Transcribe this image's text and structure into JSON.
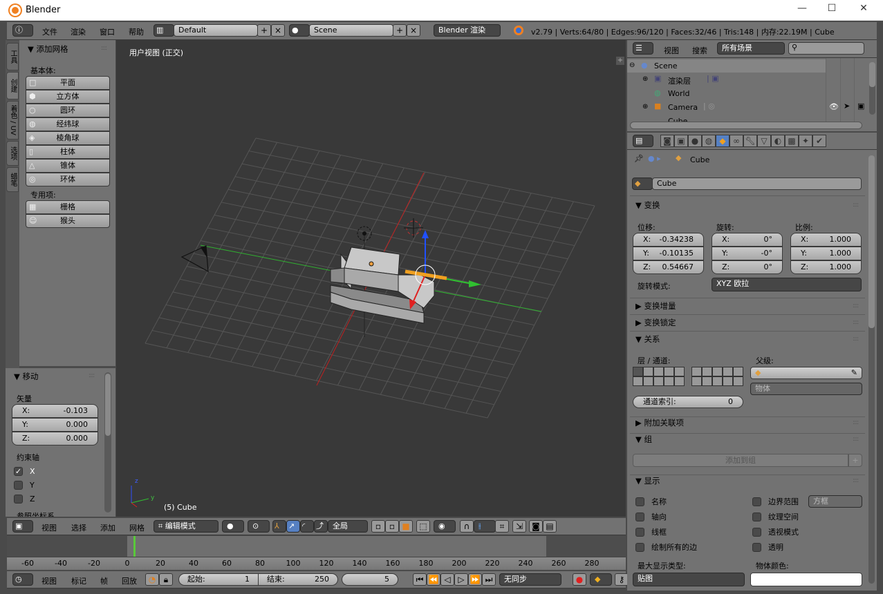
{
  "window": {
    "title": "Blender",
    "minimize": "—",
    "maximize": "☐",
    "close": "✕"
  },
  "info_header": {
    "menus": [
      "文件",
      "渲染",
      "窗口",
      "帮助"
    ],
    "layout": "Default",
    "scene": "Scene",
    "engine": "Blender 渲染",
    "stats": "v2.79 | Verts:64/80 | Edges:96/120 | Faces:32/46 | Tris:148 | 内存:22.19M | Cube"
  },
  "tool_tabs": [
    "工具",
    "创建",
    "着色 / UV",
    "选项",
    "蜡笔"
  ],
  "add_mesh": {
    "title": "添加网格",
    "primitives_label": "基本体:",
    "primitives": [
      "平面",
      "立方体",
      "圆环",
      "经纬球",
      "棱角球",
      "柱体",
      "锥体",
      "环体"
    ],
    "special_label": "专用项:",
    "special": [
      "栅格",
      "猴头"
    ]
  },
  "operator": {
    "title": "移动",
    "vector_label": "矢量",
    "vector": [
      {
        "axis": "X:",
        "value": "-0.103"
      },
      {
        "axis": "Y:",
        "value": "0.000"
      },
      {
        "axis": "Z:",
        "value": "0.000"
      }
    ],
    "constraint_label": "约束轴",
    "constraints": [
      {
        "axis": "X",
        "checked": true
      },
      {
        "axis": "Y",
        "checked": false
      },
      {
        "axis": "Z",
        "checked": false
      }
    ],
    "orientation_label": "参照坐标系"
  },
  "viewport": {
    "view_label": "用户视图 (正交)",
    "object_label": "(5) Cube",
    "axis_z": "z",
    "axis_y": "y",
    "colors": {
      "background": "#393939",
      "x_axis": "#c02020",
      "y_axis": "#30b030",
      "active": "#f0a020"
    }
  },
  "view3d_header": {
    "menus": [
      "视图",
      "选择",
      "添加",
      "网格"
    ],
    "mode": "编辑模式",
    "orientation": "全局"
  },
  "timeline": {
    "ticks": [
      "-60",
      "-40",
      "-20",
      "0",
      "20",
      "40",
      "60",
      "80",
      "100",
      "120",
      "140",
      "160",
      "180",
      "200",
      "220",
      "240",
      "260",
      "280"
    ],
    "current_frame": 5,
    "menus": [
      "视图",
      "标记",
      "帧",
      "回放"
    ],
    "start_label": "起始:",
    "start": "1",
    "end_label": "结束:",
    "end": "250",
    "frame": "5",
    "sync": "无同步"
  },
  "outliner": {
    "menus": [
      "视图",
      "搜索"
    ],
    "filter": "所有场景",
    "search_placeholder": "",
    "items": [
      {
        "label": "Scene"
      },
      {
        "label": "渲染层"
      },
      {
        "label": "World"
      },
      {
        "label": "Camera"
      },
      {
        "label": "Cube"
      }
    ]
  },
  "properties": {
    "breadcrumb": "Cube",
    "object_name": "Cube",
    "transform": {
      "title": "变换",
      "location_label": "位移:",
      "rotation_label": "旋转:",
      "scale_label": "比例:",
      "location": [
        {
          "axis": "X:",
          "value": "-0.34238"
        },
        {
          "axis": "Y:",
          "value": "-0.10135"
        },
        {
          "axis": "Z:",
          "value": "0.54667"
        }
      ],
      "rotation": [
        {
          "axis": "X:",
          "value": "0°"
        },
        {
          "axis": "Y:",
          "value": "-0°"
        },
        {
          "axis": "Z:",
          "value": "0°"
        }
      ],
      "scale": [
        {
          "axis": "X:",
          "value": "1.000"
        },
        {
          "axis": "Y:",
          "value": "1.000"
        },
        {
          "axis": "Z:",
          "value": "1.000"
        }
      ],
      "rotation_mode_label": "旋转模式:",
      "rotation_mode": "XYZ 欧拉"
    },
    "delta_transform": "变换增量",
    "transform_locks": "变换锁定",
    "relations": {
      "title": "关系",
      "layers_label": "层 / 通道:",
      "parent_label": "父级:",
      "parent_type": "物体",
      "pass_index_label": "通道索引:",
      "pass_index": "0"
    },
    "extras": "附加关联项",
    "groups": {
      "title": "组",
      "add": "添加到组"
    },
    "display": {
      "title": "显示",
      "left": [
        "名称",
        "轴向",
        "线框",
        "绘制所有的边"
      ],
      "right": [
        "边界范围",
        "纹理空间",
        "透视模式",
        "透明"
      ],
      "bounds_type": "方框",
      "max_draw_label": "最大显示类型:",
      "max_draw": "贴图",
      "color_label": "物体颜色:"
    }
  }
}
